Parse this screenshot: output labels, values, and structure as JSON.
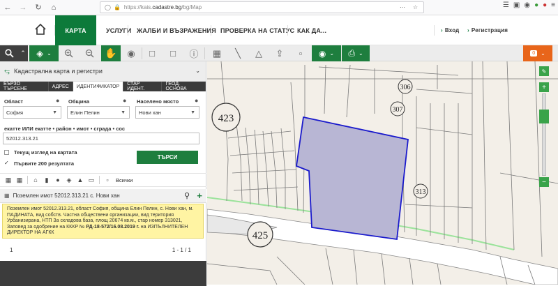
{
  "browser": {
    "url_prefix": "https://kais.",
    "url_domain": "cadastre.bg",
    "url_path": "/bg/Map"
  },
  "nav": {
    "items": [
      "КАРТА",
      "УСЛУГИ",
      "ЖАЛБИ И ВЪЗРАЖЕНИЯ",
      "ПРОВЕРКА НА СТАТУС",
      "КАК ДА..."
    ],
    "login": "Вход",
    "register": "Регистрация"
  },
  "toolbar": {
    "badge": "0"
  },
  "panel": {
    "title": "Кадастрална карта и регистри",
    "tabs": [
      "БЪРЗО ТЪРСЕНЕ",
      "АДРЕС",
      "ИДЕНТИФИКАТОР",
      "СТАР ИДЕНТ.",
      "ГЕОД. ОСНОВА"
    ],
    "active_tab": 2,
    "oblast_label": "Област",
    "oblast_value": "София",
    "obshtina_label": "Община",
    "obshtina_value": "Елин Пелин",
    "naseleno_label": "Населено място",
    "naseleno_value": "Нови хан",
    "ekatte_label": "екатте ИЛИ екатте • район • имот • сграда • сос",
    "ekatte_value": "52012.313.21",
    "current_view_label": "Текущ изглед на картата",
    "first200_label": "Първите 200 резултата",
    "search_label": "ТЪРСИ",
    "all_label": "Всички",
    "result_header": "Поземлен имот 52012.313.21 с. Нови хан",
    "result_text_1": "Поземлен имот 52012.313.21, област София, община Елин Пелин, с. Нови хан, м. ПАДИНАТА, вид собств. Частна обществени организации, вид територия Урбанизирана, НТП За складова база, площ 20674 кв.м., стар номер 313021, Заповед за одобрение на КККР №",
    "result_text_bold": "РД-18-572/16.08.2019 г.",
    "result_text_2": "на ИЗПЪЛНИТЕЛЕН ДИРЕКТОР НА АГКК",
    "page_number": "1",
    "page_range": "1 - 1 / 1"
  },
  "map": {
    "labels": {
      "q423": "423",
      "q425": "425",
      "q306": "306",
      "q307": "307",
      "q313": "313"
    },
    "highlight_fill": "#b8b6d4",
    "highlight_stroke": "#1a1acc",
    "road_color": "#ffffff",
    "road_edge": "#9be39b"
  },
  "colors": {
    "brand_green": "#0d7a3a",
    "accent_orange": "#e8651a",
    "panel_dark": "#3a3a3a"
  }
}
